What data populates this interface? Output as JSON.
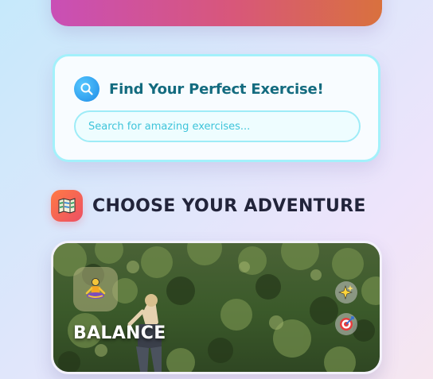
{
  "search": {
    "title": "Find Your Perfect Exercise!",
    "placeholder": "Search for amazing exercises...",
    "icon": "search-icon"
  },
  "section": {
    "title": "CHOOSE YOUR ADVENTURE",
    "icon": "map-icon"
  },
  "exercise_card": {
    "title": "BALANCE",
    "icon": "meditation-icon",
    "tags": [
      "sparkles-icon",
      "target-icon"
    ]
  },
  "colors": {
    "hero_gradient": [
      "#c94fb6",
      "#d9713e"
    ],
    "search_title": "#136b7f",
    "search_border": "#a3f1fb",
    "section_title": "#22243a",
    "section_badge": [
      "#ff7a45",
      "#ec5063"
    ]
  }
}
